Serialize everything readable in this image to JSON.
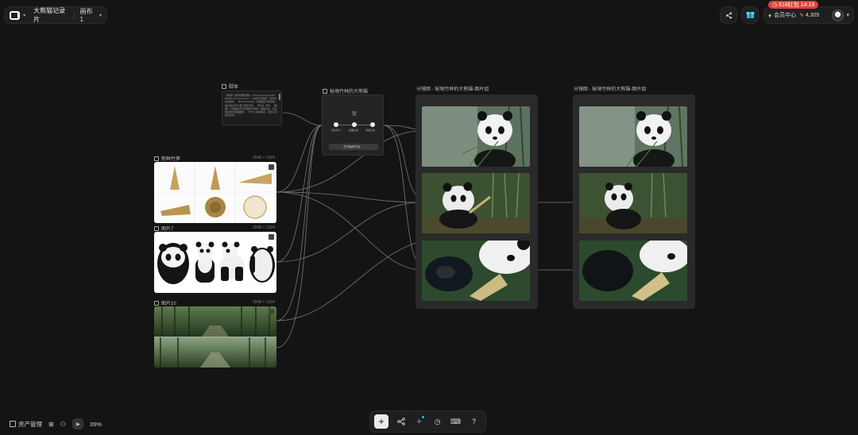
{
  "project": {
    "title": "大熊猫记录片",
    "canvas_name": "画布 1"
  },
  "account": {
    "promo": "618红包 14:19",
    "member_center": "会员中心",
    "credits": "4,305"
  },
  "nodes": {
    "script": {
      "label": "脚本",
      "text": "【视频】国家地理纪录片《National Geographic Wildlife Documentary》，4K超高清画质，自然光，真实摄影。【Photorealistic】大熊猫在竹林深处，晨光透过竹叶洒下斑驳光影。【开头】中景，【画面】大熊猫在雾气弥漫的竹林中，缓缓走出，镜头推进特写熊猫面部……竹叶上挂着露水，远处山峦若隐若现……"
    },
    "workflow": {
      "label": "秘境竹林的大熊猫",
      "steps": [
        "镜头拆分",
        "画面生成",
        "视频生成"
      ],
      "button": "打开画布节点 →"
    },
    "bamboo": {
      "label": "新鲜竹笋",
      "dims": "2048 × 1024"
    },
    "panda": {
      "label": "图片7",
      "dims": "2048 × 1024"
    },
    "forest": {
      "label": "图片10",
      "dims": "2048 × 1024"
    },
    "storyboard_a": {
      "label": "分镜图 - 秘境竹林的大熊猫-图片组"
    },
    "storyboard_b": {
      "label": "分镜图 - 秘境竹林的大熊猫-图片组"
    }
  },
  "bottom": {
    "asset_manager": "资产管理",
    "zoom": "39%"
  },
  "icons": [
    "logo-icon",
    "chevron-down-icon",
    "share-icon",
    "gift-store-icon",
    "vip-icon",
    "lightning-icon",
    "avatar",
    "sidebar-icon",
    "grid-icon",
    "people-icon",
    "cursor-icon",
    "add-icon",
    "workflow-icon",
    "magic-icon",
    "history-icon",
    "keyboard-icon",
    "help-icon"
  ],
  "colors": {
    "background": "#141414",
    "promo": "#e0413a",
    "panel": "#2a2a2a"
  }
}
